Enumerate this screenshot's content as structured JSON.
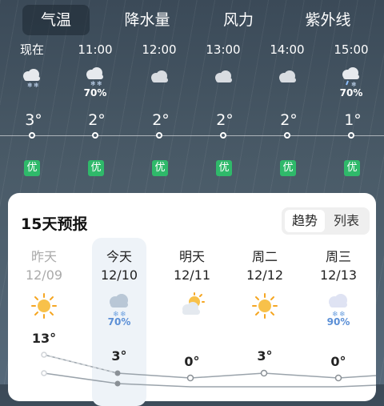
{
  "tabs": [
    {
      "label": "气温",
      "active": true
    },
    {
      "label": "降水量",
      "active": false
    },
    {
      "label": "风力",
      "active": false
    },
    {
      "label": "紫外线",
      "active": false
    }
  ],
  "hourly": [
    {
      "time": "现在",
      "icon": "snow-cloud-icon",
      "precip": "",
      "temp": "3°",
      "aqi": "优"
    },
    {
      "time": "11:00",
      "icon": "snow-cloud-icon",
      "precip": "70%",
      "temp": "2°",
      "aqi": "优"
    },
    {
      "time": "12:00",
      "icon": "cloud-icon",
      "precip": "",
      "temp": "2°",
      "aqi": "优"
    },
    {
      "time": "13:00",
      "icon": "cloud-icon",
      "precip": "",
      "temp": "2°",
      "aqi": "优"
    },
    {
      "time": "14:00",
      "icon": "cloud-icon",
      "precip": "",
      "temp": "2°",
      "aqi": "优"
    },
    {
      "time": "15:00",
      "icon": "sleet-cloud-icon",
      "precip": "70%",
      "temp": "1°",
      "aqi": "优"
    }
  ],
  "forecast": {
    "title": "15天预报",
    "toggle": [
      {
        "label": "趋势",
        "active": true
      },
      {
        "label": "列表",
        "active": false
      }
    ],
    "days": [
      {
        "name": "昨天",
        "date": "12/09",
        "icon": "sun-icon",
        "precip": "",
        "high": "13°",
        "past": true
      },
      {
        "name": "今天",
        "date": "12/10",
        "icon": "snow-cloud-icon",
        "precip": "70%",
        "high": "3°",
        "past": false
      },
      {
        "name": "明天",
        "date": "12/11",
        "icon": "partly-cloudy-icon",
        "precip": "",
        "high": "0°",
        "past": false
      },
      {
        "name": "周二",
        "date": "12/12",
        "icon": "sun-icon",
        "precip": "",
        "high": "3°",
        "past": false
      },
      {
        "name": "周三",
        "date": "12/13",
        "icon": "snow-cloud-icon",
        "precip": "90%",
        "high": "0°",
        "past": false
      }
    ]
  },
  "colors": {
    "aqi_good": "#2fb96a",
    "precip_text": "#5b8fd6",
    "sun": "#f5a623"
  }
}
